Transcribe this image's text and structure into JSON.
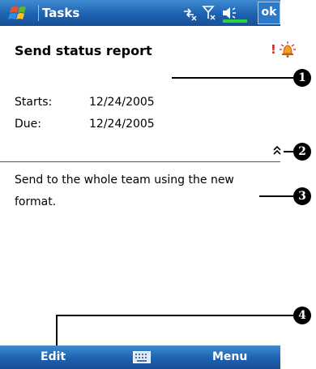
{
  "titlebar": {
    "app_title": "Tasks",
    "ok_label": "ok",
    "icons": [
      "windows-start-icon",
      "connectivity-icon",
      "signal-off-icon",
      "volume-icon",
      "battery-icon"
    ]
  },
  "task": {
    "subject": "Send status report",
    "priority_mark": "!",
    "starts_label": "Starts:",
    "starts_value": "12/24/2005",
    "due_label": "Due:",
    "due_value": "12/24/2005",
    "notes": "Send to the whole team using the new format."
  },
  "callouts": [
    "1",
    "2",
    "3",
    "4"
  ],
  "menubar": {
    "edit_label": "Edit",
    "menu_label": "Menu",
    "icons": [
      "keyboard-icon"
    ]
  },
  "colors": {
    "bar_blue": "#1d62b0",
    "priority_red": "#e11d1d",
    "text": "#000000"
  }
}
